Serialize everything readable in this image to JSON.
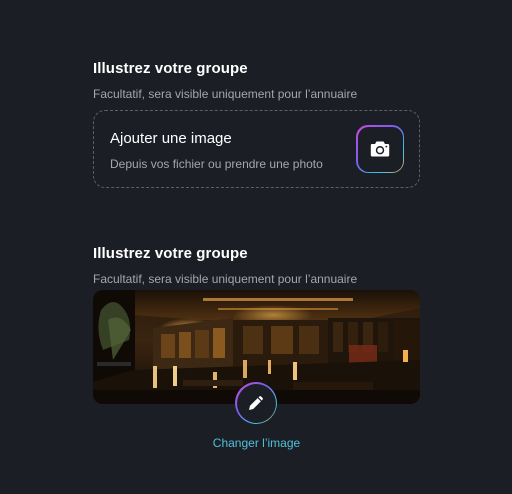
{
  "sections": [
    {
      "title": "Illustrez votre groupe",
      "subtitle": "Facultatif, sera visible uniquement pour l’annuaire",
      "upload": {
        "title": "Ajouter une image",
        "subtitle": "Depuis vos fichier ou prendre une photo",
        "icon": "camera-icon"
      }
    },
    {
      "title": "Illustrez votre groupe",
      "subtitle": "Facultatif, sera visible uniquement pour l’annuaire",
      "image": {
        "edit_icon": "pencil-icon",
        "change_label": "Changer l’image"
      }
    }
  ],
  "colors": {
    "background": "#1c1e26",
    "link": "#4ec1d9",
    "muted_text": "#a3a6b1",
    "dashed_border": "#5b5f6d"
  }
}
